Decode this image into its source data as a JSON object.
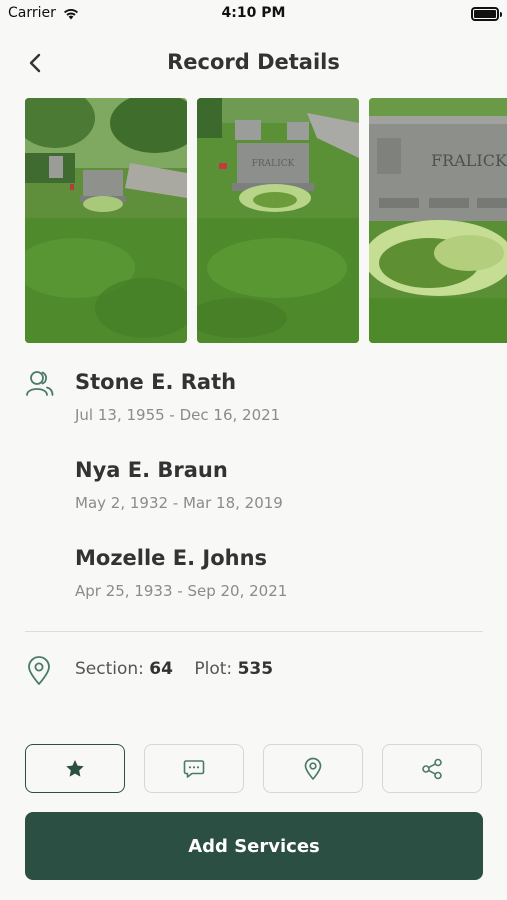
{
  "status_bar": {
    "carrier": "Carrier",
    "time": "4:10 PM"
  },
  "header": {
    "title": "Record Details"
  },
  "gallery": {
    "photos": [
      {
        "label": ""
      },
      {
        "label": "FRALICK"
      },
      {
        "label": "FRALICK"
      }
    ]
  },
  "people": [
    {
      "name": "Stone E. Rath",
      "dates": "Jul 13, 1955 - Dec 16, 2021"
    },
    {
      "name": "Nya E. Braun",
      "dates": "May 2, 1932 - Mar 18, 2019"
    },
    {
      "name": "Mozelle E. Johns",
      "dates": "Apr 25, 1933 - Sep 20, 2021"
    }
  ],
  "location": {
    "section_label": "Section:",
    "section_value": "64",
    "plot_label": "Plot:",
    "plot_value": "535"
  },
  "actions": [
    {
      "icon": "star-icon",
      "active": true
    },
    {
      "icon": "message-icon",
      "active": false
    },
    {
      "icon": "map-pin-icon",
      "active": false
    },
    {
      "icon": "share-icon",
      "active": false
    }
  ],
  "primary_button": {
    "label": "Add Services"
  },
  "colors": {
    "accent": "#2c4f44",
    "icon_green": "#4a7a6a",
    "text_dark": "#333333",
    "text_muted": "#8b8b8b"
  }
}
